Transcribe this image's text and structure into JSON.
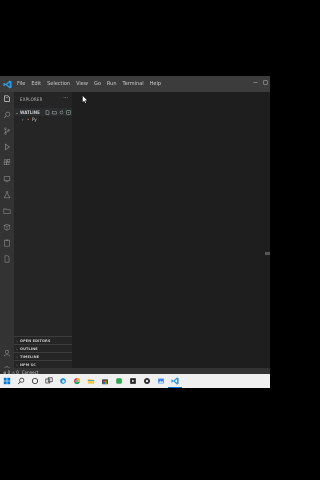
{
  "menubar": {
    "items": [
      "File",
      "Edit",
      "Selection",
      "View",
      "Go",
      "Run",
      "Terminal",
      "Help"
    ]
  },
  "activity_bar": {
    "icons": [
      "explorer-icon",
      "search-icon",
      "source-control-icon",
      "run-debug-icon",
      "extensions-icon",
      "remote-icon",
      "test-icon",
      "folder-icon",
      "package-icon",
      "clipboard-icon",
      "file-icon",
      "account-icon",
      "settings-icon"
    ]
  },
  "sidebar": {
    "title": "EXPLORER",
    "title_more": "···",
    "folder": {
      "name": "WATLINE",
      "caret": "⌄"
    },
    "files": [
      {
        "caret": "›",
        "icon": "•",
        "name": "Py"
      }
    ],
    "sections": [
      {
        "caret": "›",
        "name": "OPEN EDITORS"
      },
      {
        "caret": "›",
        "name": "OUTLINE"
      },
      {
        "caret": "›",
        "name": "TIMELINE"
      },
      {
        "caret": "›",
        "name": "NPM SC"
      }
    ]
  },
  "statusbar": {
    "left": "⊗ 0 ⚠ 0",
    "connect": "Connect"
  },
  "colors": {
    "accent": "#0078d4",
    "editor_bg": "#1e1e1e",
    "sidebar_bg": "#252526",
    "activity_bg": "#333333",
    "titlebar_bg": "#3c3c3c",
    "taskbar_bg": "#f0f0f0"
  },
  "taskbar": {
    "icons": [
      "windows-start-icon",
      "search-icon",
      "cortana-icon",
      "task-view-icon",
      "edge-icon",
      "chrome-icon",
      "explorer-icon",
      "store-icon",
      "app-icon",
      "media-icon",
      "obs-icon",
      "photos-icon",
      "vscode-icon"
    ]
  }
}
